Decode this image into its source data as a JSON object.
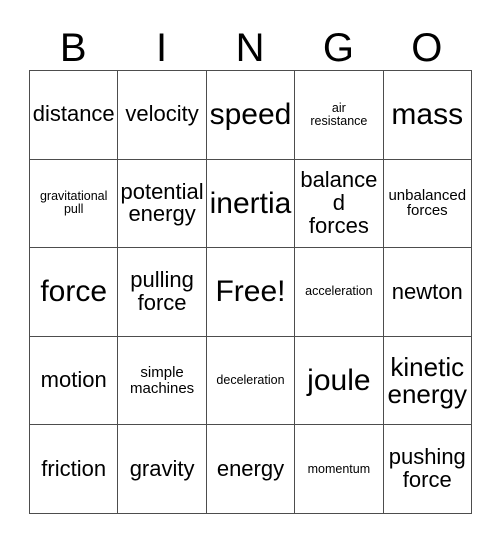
{
  "card": {
    "title": "BINGO",
    "header_letters": [
      "B",
      "I",
      "N",
      "G",
      "O"
    ],
    "free_space_label": "Free!",
    "free_space_position": {
      "row": 3,
      "col": 3
    },
    "grid_size": "5x5",
    "border_color": "#4d4d4d",
    "background_color": "#ffffff",
    "text_color": "#000000",
    "rows": [
      [
        {
          "text": "distance",
          "size": "md"
        },
        {
          "text": "velocity",
          "size": "md"
        },
        {
          "text": "speed",
          "size": "xl"
        },
        {
          "text": "air\nresistance",
          "size": "xxs"
        },
        {
          "text": "mass",
          "size": "xl"
        }
      ],
      [
        {
          "text": "gravitational\npull",
          "size": "xxs"
        },
        {
          "text": "potential\nenergy",
          "size": "md"
        },
        {
          "text": "inertia",
          "size": "xl"
        },
        {
          "text": "balanced\nforces",
          "size": "md"
        },
        {
          "text": "unbalanced\nforces",
          "size": "xs"
        }
      ],
      [
        {
          "text": "force",
          "size": "xl"
        },
        {
          "text": "pulling\nforce",
          "size": "md"
        },
        {
          "text": "Free!",
          "size": "xl"
        },
        {
          "text": "acceleration",
          "size": "xxs"
        },
        {
          "text": "newton",
          "size": "md"
        }
      ],
      [
        {
          "text": "motion",
          "size": "md"
        },
        {
          "text": "simple\nmachines",
          "size": "xs"
        },
        {
          "text": "deceleration",
          "size": "xxs"
        },
        {
          "text": "joule",
          "size": "xl"
        },
        {
          "text": "kinetic\nenergy",
          "size": "lg"
        }
      ],
      [
        {
          "text": "friction",
          "size": "md"
        },
        {
          "text": "gravity",
          "size": "md"
        },
        {
          "text": "energy",
          "size": "md"
        },
        {
          "text": "momentum",
          "size": "xxs"
        },
        {
          "text": "pushing\nforce",
          "size": "md"
        }
      ]
    ]
  }
}
